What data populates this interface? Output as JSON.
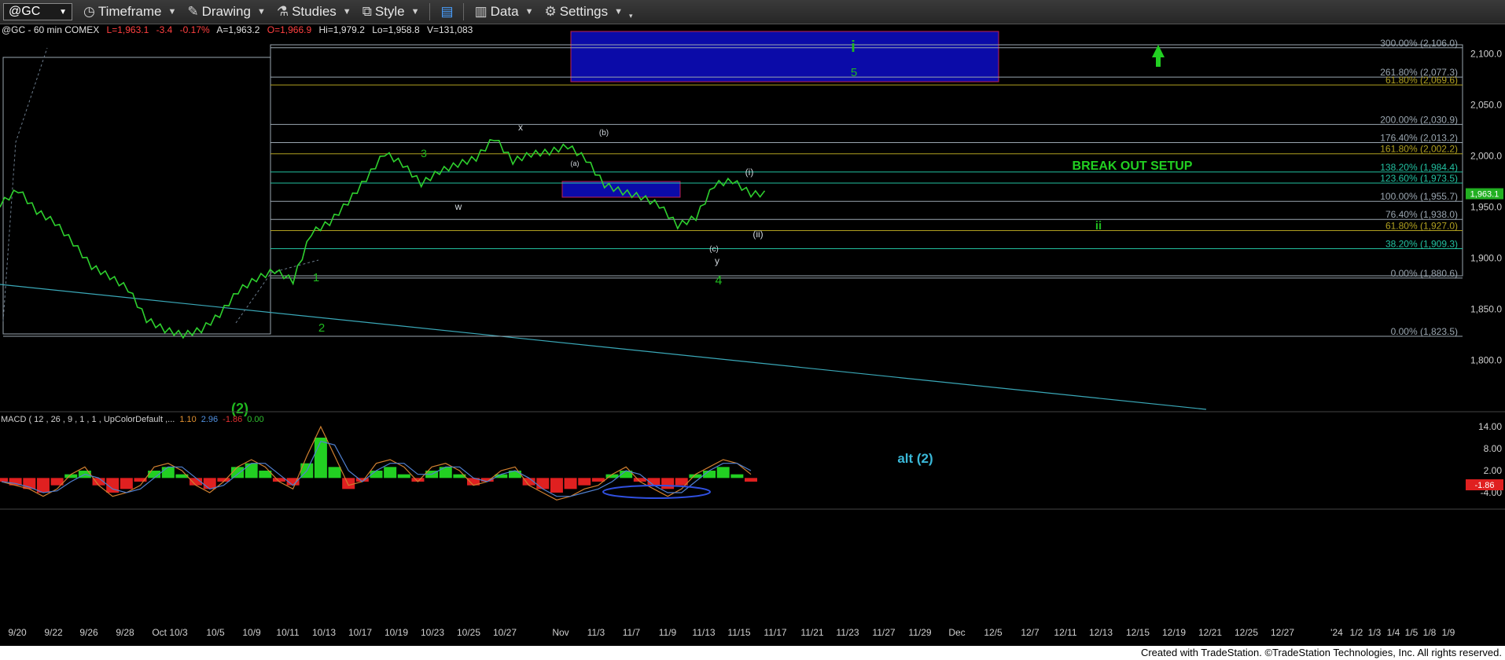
{
  "toolbar": {
    "symbol": "@GC",
    "timeframe": "Timeframe",
    "drawing": "Drawing",
    "studies": "Studies",
    "style": "Style",
    "data": "Data",
    "settings": "Settings"
  },
  "header_info": "@GC - 60 min  COMEX",
  "quote": {
    "last": "L=1,963.1",
    "change": "-3.4",
    "pct": "-0.17%",
    "ask": "A=1,963.2",
    "open": "O=1,966.9",
    "high": "Hi=1,979.2",
    "low": "Lo=1,958.8",
    "volume": "V=131,083"
  },
  "colors": {
    "price": "#2ed02e",
    "wave_green": "#1fb81f",
    "fib_line": "#9aa6b0",
    "fib_green": "#22c0a0",
    "fib_olive": "#b0a020",
    "box_blue": "#0b0ba8",
    "trendline": "#3aa8b8",
    "macd_pos": "#22d022",
    "macd_neg": "#e02020",
    "macd_line": "#d08030",
    "signal_line": "#5080d0"
  },
  "chart_data": {
    "type": "line",
    "title": "@GC - 60 min COMEX",
    "ylim": [
      1752,
      2122
    ],
    "y_ticks": [
      1800,
      1850,
      1900,
      1950,
      2000,
      2050,
      2100
    ],
    "y_tick_labels": [
      "1,800.0",
      "1,850.0",
      "1,900.0",
      "1,950.0",
      "2,000.0",
      "2,050.0",
      "2,100.0"
    ],
    "x_tick_labels": [
      "9/20",
      "9/22",
      "9/26",
      "9/28",
      "Oct 10/3",
      "10/5",
      "10/9",
      "10/11",
      "10/13",
      "10/17",
      "10/19",
      "10/23",
      "10/25",
      "10/27",
      "Nov",
      "11/3",
      "11/7",
      "11/9",
      "11/13",
      "11/15",
      "11/17",
      "11/21",
      "11/23",
      "11/27",
      "11/29",
      "Dec",
      "12/5",
      "12/7",
      "12/11",
      "12/13",
      "12/15",
      "12/19",
      "12/21",
      "12/25",
      "12/27",
      "'24",
      "1/2",
      "1/3",
      "1/4",
      "1/5",
      "1/8",
      "1/9"
    ],
    "price_series": {
      "x": [
        "9/20",
        "9/21",
        "9/22",
        "9/25",
        "9/26",
        "9/27",
        "9/28",
        "9/29",
        "10/2",
        "10/3",
        "10/4",
        "10/5",
        "10/6",
        "10/9",
        "10/10",
        "10/11",
        "10/12",
        "10/13",
        "10/16",
        "10/17",
        "10/18",
        "10/19",
        "10/20",
        "10/23",
        "10/24",
        "10/25",
        "10/26",
        "10/27",
        "10/30",
        "10/31",
        "11/1",
        "11/2",
        "11/3",
        "11/6",
        "11/7",
        "11/8",
        "11/9",
        "11/10",
        "11/13",
        "11/14",
        "11/15",
        "11/16"
      ],
      "values": [
        1953,
        1967,
        1946,
        1935,
        1915,
        1892,
        1882,
        1870,
        1840,
        1830,
        1825,
        1830,
        1845,
        1868,
        1880,
        1888,
        1878,
        1925,
        1935,
        1955,
        1978,
        2003,
        1992,
        1973,
        1985,
        1992,
        1998,
        2018,
        1995,
        2002,
        2004,
        2010,
        1997,
        1972,
        1965,
        1960,
        1952,
        1932,
        1940,
        1972,
        1976,
        1963
      ]
    },
    "last_price": 1963.1,
    "last_price_label": "1,963.1",
    "fib_levels": [
      {
        "label": "300.00% (2,106.0)",
        "value": 2106.0
      },
      {
        "label": "261.80% (2,077.3)",
        "value": 2077.3
      },
      {
        "label": "61.80% (2,069.6)",
        "value": 2069.6
      },
      {
        "label": "200.00% (2,030.9)",
        "value": 2030.9
      },
      {
        "label": "176.40% (2,013.2)",
        "value": 2013.2
      },
      {
        "label": "161.80% (2,002.2)",
        "value": 2002.2
      },
      {
        "label": "138.20% (1,984.4)",
        "value": 1984.4
      },
      {
        "label": "123.60% (1,973.5)",
        "value": 1973.5
      },
      {
        "label": "100.00% (1,955.7)",
        "value": 1955.7
      },
      {
        "label": "76.40% (1,938.0)",
        "value": 1938.0
      },
      {
        "label": "61.80% (1,927.0)",
        "value": 1927.0
      },
      {
        "label": "38.20% (1,909.3)",
        "value": 1909.3
      },
      {
        "label": "0.00% (1,880.6)",
        "value": 1880.6
      },
      {
        "label": "0.00% (1,823.5)",
        "value": 1823.5
      }
    ],
    "wave_labels": [
      "(2)",
      "1",
      "2",
      "3",
      "4",
      "5",
      "i",
      "ii",
      "w",
      "x",
      "y",
      "(a)",
      "(b)",
      "(c)",
      "(i)",
      "(ii)",
      "alt (2)"
    ],
    "annotation": "BREAK OUT SETUP",
    "target_box": {
      "y_low": 2070,
      "y_high": 2120
    },
    "support_box": {
      "y_low": 1959,
      "y_high": 1972
    },
    "macd": {
      "label": "MACD ( 12 , 26 , 9 , 1 , 1 , UpColorDefault ,...",
      "values": [
        "1.10",
        "2.96",
        "-1.86",
        "0.00"
      ],
      "ylim": [
        -7,
        17
      ],
      "ticks": [
        "14.00",
        "8.00",
        "2.00",
        "-4.00"
      ],
      "tick_values": [
        14,
        8,
        2,
        -4
      ],
      "last_hist_label": "-1.86",
      "hist": [
        -1,
        -2,
        -3,
        -4,
        -2,
        1,
        2,
        -2,
        -4,
        -3,
        -1,
        2,
        3,
        1,
        -2,
        -3,
        -1,
        3,
        4,
        2,
        -1,
        -2,
        4,
        11,
        3,
        -3,
        -1,
        2,
        3,
        1,
        -1,
        2,
        3,
        1,
        -2,
        -1,
        1,
        2,
        -2,
        -3,
        -4,
        -3,
        -2,
        -1,
        1,
        2,
        -1,
        -2,
        -3,
        -2,
        1,
        2,
        3,
        1,
        -1
      ],
      "macd_line": [
        -1,
        -2,
        -3,
        -5,
        -3,
        1,
        3,
        -2,
        -5,
        -4,
        -2,
        3,
        4,
        2,
        -2,
        -4,
        -1,
        3,
        5,
        3,
        -1,
        -3,
        6,
        14,
        6,
        -2,
        -1,
        4,
        5,
        3,
        -1,
        3,
        4,
        2,
        -2,
        -1,
        2,
        3,
        -2,
        -4,
        -6,
        -5,
        -3,
        -2,
        1,
        3,
        -1,
        -3,
        -5,
        -3,
        1,
        3,
        5,
        4,
        1
      ],
      "signal_line": [
        -1,
        -1.5,
        -2.5,
        -4,
        -3.5,
        -1,
        1,
        0,
        -3,
        -4,
        -3,
        0,
        3,
        3,
        0,
        -3,
        -2,
        1,
        4,
        4,
        1,
        -2,
        2,
        10,
        9,
        2,
        -1,
        2,
        4,
        4,
        1,
        1,
        3,
        3,
        0,
        -1,
        1,
        2,
        0,
        -3,
        -5,
        -5,
        -4,
        -3,
        -1,
        2,
        1,
        -2,
        -4,
        -4,
        -1,
        2,
        4,
        4,
        2
      ]
    }
  },
  "footer": "Created with TradeStation. ©TradeStation Technologies, Inc. All rights reserved."
}
